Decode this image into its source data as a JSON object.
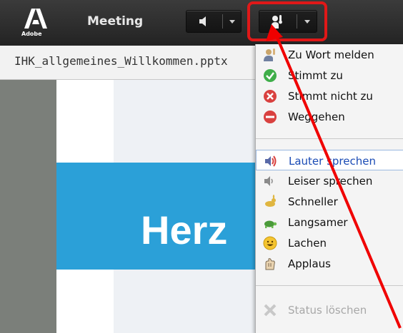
{
  "app": {
    "logo_text": "Adobe",
    "title": "Meeting"
  },
  "document": {
    "tab_label": "IHK_allgemeines_Willkommen.pptx"
  },
  "slide": {
    "visible_text": "Herz"
  },
  "status_menu": {
    "items_group1": [
      {
        "label": "Zu Wort melden",
        "icon": "raise-hand-icon"
      },
      {
        "label": "Stimmt zu",
        "icon": "agree-check-icon"
      },
      {
        "label": "Stimmt nicht zu",
        "icon": "disagree-x-icon"
      },
      {
        "label": "Weggehen",
        "icon": "step-away-icon"
      }
    ],
    "items_group2": [
      {
        "label": "Lauter sprechen",
        "icon": "speaker-louder-icon",
        "selected": true
      },
      {
        "label": "Leiser sprechen",
        "icon": "speaker-softer-icon"
      },
      {
        "label": "Schneller",
        "icon": "rabbit-faster-icon"
      },
      {
        "label": "Langsamer",
        "icon": "turtle-slower-icon"
      },
      {
        "label": "Lachen",
        "icon": "smiley-laugh-icon"
      },
      {
        "label": "Applaus",
        "icon": "applause-hands-icon"
      }
    ],
    "clear_item": {
      "label": "Status löschen",
      "icon": "clear-x-icon",
      "disabled": true
    }
  },
  "colors": {
    "highlight": "#e01818",
    "selected_text": "#1a4bb5",
    "slide_blue": "#2ba0d8"
  }
}
